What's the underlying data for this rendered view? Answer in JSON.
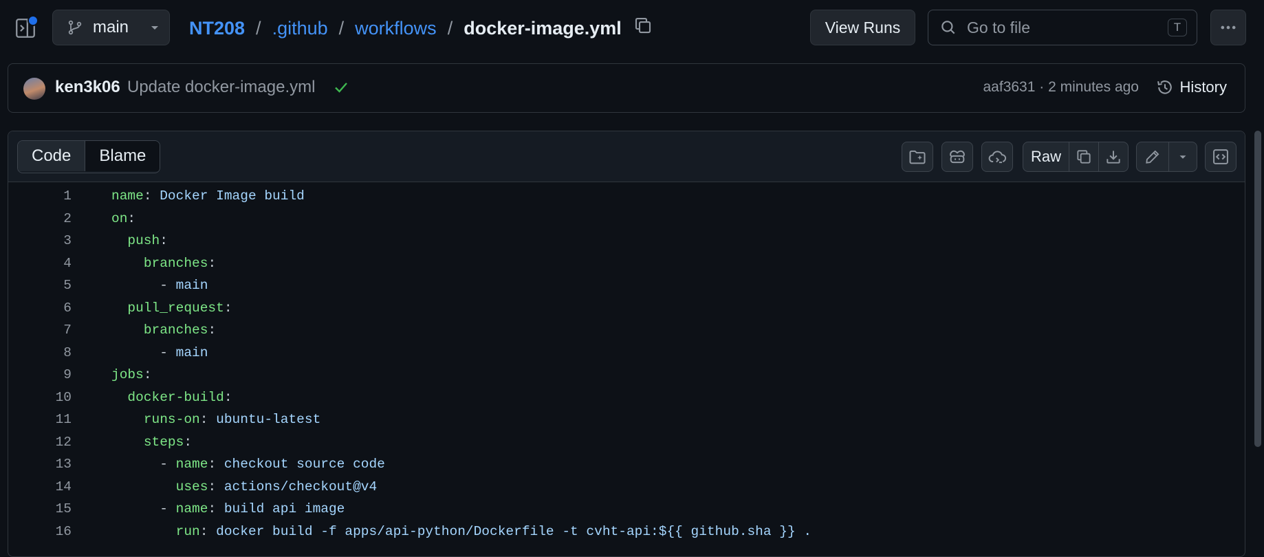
{
  "header": {
    "branch": "main",
    "breadcrumb": {
      "repo": "NT208",
      "folder1": ".github",
      "folder2": "workflows",
      "sep": "/",
      "file": "docker-image.yml"
    },
    "view_runs": "View Runs",
    "search_placeholder": "Go to file",
    "search_shortcut": "T"
  },
  "commit": {
    "author": "ken3k06",
    "message": "Update docker-image.yml",
    "meta": "aaf3631 · 2 minutes ago",
    "history_label": "History"
  },
  "file_view": {
    "tabs": {
      "code": "Code",
      "blame": "Blame"
    },
    "raw_label": "Raw"
  },
  "code_lines": [
    {
      "n": "1",
      "indent": "",
      "dash": "",
      "key": "name",
      "sep": ": ",
      "val": "Docker Image build"
    },
    {
      "n": "2",
      "indent": "",
      "dash": "",
      "key": "on",
      "sep": ":",
      "val": ""
    },
    {
      "n": "3",
      "indent": "  ",
      "dash": "",
      "key": "push",
      "sep": ":",
      "val": ""
    },
    {
      "n": "4",
      "indent": "    ",
      "dash": "",
      "key": "branches",
      "sep": ":",
      "val": ""
    },
    {
      "n": "5",
      "indent": "      ",
      "dash": "- ",
      "key": "",
      "sep": "",
      "val": "main"
    },
    {
      "n": "6",
      "indent": "  ",
      "dash": "",
      "key": "pull_request",
      "sep": ":",
      "val": ""
    },
    {
      "n": "7",
      "indent": "    ",
      "dash": "",
      "key": "branches",
      "sep": ":",
      "val": ""
    },
    {
      "n": "8",
      "indent": "      ",
      "dash": "- ",
      "key": "",
      "sep": "",
      "val": "main"
    },
    {
      "n": "9",
      "indent": "",
      "dash": "",
      "key": "jobs",
      "sep": ":",
      "val": ""
    },
    {
      "n": "10",
      "indent": "  ",
      "dash": "",
      "key": "docker-build",
      "sep": ":",
      "val": ""
    },
    {
      "n": "11",
      "indent": "    ",
      "dash": "",
      "key": "runs-on",
      "sep": ": ",
      "val": "ubuntu-latest"
    },
    {
      "n": "12",
      "indent": "    ",
      "dash": "",
      "key": "steps",
      "sep": ":",
      "val": ""
    },
    {
      "n": "13",
      "indent": "      ",
      "dash": "- ",
      "key": "name",
      "sep": ": ",
      "val": "checkout source code"
    },
    {
      "n": "14",
      "indent": "        ",
      "dash": "",
      "key": "uses",
      "sep": ": ",
      "val": "actions/checkout@v4"
    },
    {
      "n": "15",
      "indent": "      ",
      "dash": "- ",
      "key": "name",
      "sep": ": ",
      "val": "build api image"
    },
    {
      "n": "16",
      "indent": "        ",
      "dash": "",
      "key": "run",
      "sep": ": ",
      "val": "docker build -f apps/api-python/Dockerfile -t cvht-api:${{ github.sha }} ."
    }
  ],
  "colors": {
    "background": "#0d1117",
    "link": "#4493f8",
    "yaml_key": "#7ee787",
    "yaml_value": "#a5d6ff",
    "success": "#3fb950"
  }
}
